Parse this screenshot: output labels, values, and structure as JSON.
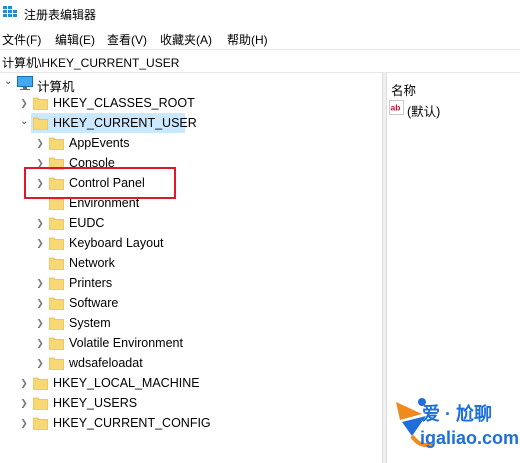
{
  "window": {
    "title": "注册表编辑器"
  },
  "menu": [
    {
      "label": "文件(F)"
    },
    {
      "label": "编辑(E)"
    },
    {
      "label": "查看(V)"
    },
    {
      "label": "收藏夹(A)"
    },
    {
      "label": "帮助(H)"
    }
  ],
  "address": "计算机\\HKEY_CURRENT_USER",
  "tree": {
    "root": "计算机",
    "hives": {
      "classes_root": "HKEY_CLASSES_ROOT",
      "current_user": "HKEY_CURRENT_USER",
      "local_machine": "HKEY_LOCAL_MACHINE",
      "users": "HKEY_USERS",
      "current_config": "HKEY_CURRENT_CONFIG"
    },
    "current_user_children": [
      "AppEvents",
      "Console",
      "Control Panel",
      "Environment",
      "EUDC",
      "Keyboard Layout",
      "Network",
      "Printers",
      "Software",
      "System",
      "Volatile Environment",
      "wdsafeloadat"
    ]
  },
  "values_pane": {
    "column_header": "名称",
    "rows": [
      {
        "name": "(默认)"
      }
    ]
  },
  "watermark": {
    "brand": "爱 · 尬聊",
    "url": "igaliao.com"
  }
}
